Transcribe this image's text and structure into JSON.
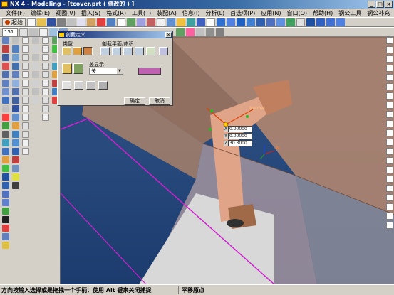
{
  "window": {
    "title": "NX 4 - Modeling - [tcover.prt ( 修改的 ) ]",
    "minimize": "_",
    "maximize": "□",
    "close": "×"
  },
  "menu": {
    "items": [
      "文件(F)",
      "编辑(E)",
      "视图(V)",
      "插入(S)",
      "格式(R)",
      "工具(T)",
      "装配(A)",
      "信息(I)",
      "分析(L)",
      "首选项(P)",
      "应用(N)",
      "窗口(O)",
      "帮助(H)",
      "钢公工具",
      "钢公补充"
    ]
  },
  "toolbar": {
    "start_label": "起始",
    "layer_combo": "151"
  },
  "dialog": {
    "title": "剖截定义",
    "close": "×",
    "type_label": "类型",
    "plane_label": "剖截平面/体积",
    "cap_label": "盖显示",
    "cap_value": "关",
    "ok_label": "确定",
    "cancel_label": "取消",
    "cap_color": "#c060b0"
  },
  "viewport": {
    "handle_label": "Normal",
    "axis_x_label": "XC",
    "coords": {
      "x": "0.00000",
      "y": "0.00000",
      "z": "30.3000"
    },
    "coord_labels": {
      "x": "X",
      "y": "Y",
      "z": "Z"
    }
  },
  "status": {
    "prompt": "方向按输入选择或是拖拽一个手柄：使用 Alt 键来关闭捕捉",
    "message": "平移原点"
  }
}
